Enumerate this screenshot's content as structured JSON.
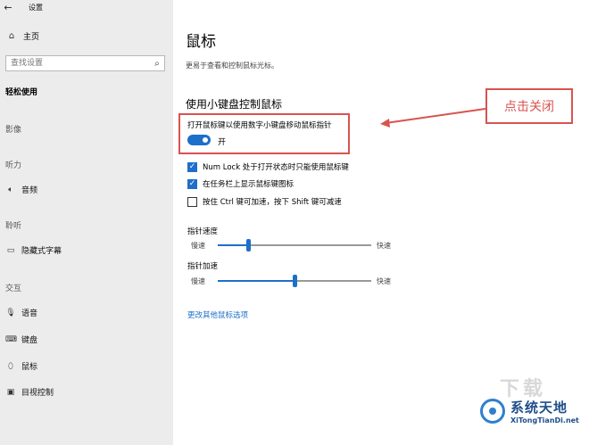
{
  "window": {
    "title": "设置"
  },
  "sidebar": {
    "home_label": "主页",
    "search_placeholder": "查找设置",
    "category": "轻松使用",
    "sections": {
      "vision": "影像",
      "hearing": "听力",
      "hearing_items": [
        "音频"
      ],
      "interaction": "交互"
    },
    "items": [
      {
        "label": "隐藏式字幕",
        "icon": "captions-icon"
      },
      {
        "label": "语音",
        "icon": "microphone-icon"
      },
      {
        "label": "键盘",
        "icon": "keyboard-icon"
      },
      {
        "label": "鼠标",
        "icon": "mouse-icon"
      },
      {
        "label": "目视控制",
        "icon": "eye-control-icon"
      }
    ],
    "section_other": "聆听"
  },
  "main": {
    "title": "鼠标",
    "description": "更易于查看和控制鼠标光标。",
    "section_title": "使用小键盘控制鼠标",
    "toggle": {
      "label": "打开鼠标键以使用数字小键盘移动鼠标指针",
      "state_text": "开",
      "on": true
    },
    "checkboxes": [
      {
        "label": "Num Lock 处于打开状态时只能使用鼠标键",
        "checked": true
      },
      {
        "label": "在任务栏上显示鼠标键图标",
        "checked": true
      },
      {
        "label": "按住 Ctrl 键可加速，按下 Shift 键可减速",
        "checked": false
      }
    ],
    "sliders": [
      {
        "label": "指针速度",
        "min_label": "慢速",
        "max_label": "快速",
        "value": 0.2
      },
      {
        "label": "指针加速",
        "min_label": "慢速",
        "max_label": "快速",
        "value": 0.5
      }
    ],
    "link": "更改其他鼠标选项"
  },
  "annotation": {
    "text": "点击关闭",
    "color": "#d9534f"
  },
  "watermark": {
    "cn": "系统天地",
    "en": "XiTongTianDi.net"
  },
  "colors": {
    "accent": "#1e6fc9",
    "sidebar_bg": "#ececec"
  }
}
